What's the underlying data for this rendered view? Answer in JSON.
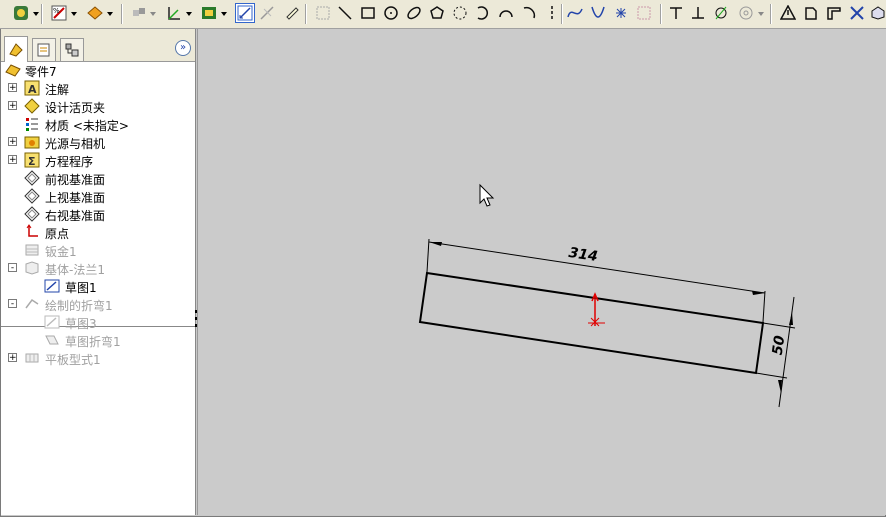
{
  "feature_tree": {
    "root": "零件7",
    "items": [
      {
        "label": "注解",
        "icon": "annotation-icon",
        "expander": "+"
      },
      {
        "label": "设计活页夹",
        "icon": "design-binder-icon",
        "expander": "+"
      },
      {
        "label": "材质 <未指定>",
        "icon": "material-icon",
        "expander": ""
      },
      {
        "label": "光源与相机",
        "icon": "lights-cameras-icon",
        "expander": "+"
      },
      {
        "label": "方程程序",
        "icon": "equations-icon",
        "expander": "+"
      },
      {
        "label": "前视基准面",
        "icon": "plane-icon",
        "expander": ""
      },
      {
        "label": "上视基准面",
        "icon": "plane-icon",
        "expander": ""
      },
      {
        "label": "右视基准面",
        "icon": "plane-icon",
        "expander": ""
      },
      {
        "label": "原点",
        "icon": "origin-icon",
        "expander": ""
      },
      {
        "label": "钣金1",
        "icon": "sheet-metal-icon",
        "expander": "",
        "dim": true
      },
      {
        "label": "基体-法兰1",
        "icon": "base-flange-icon",
        "expander": "-",
        "dim": true
      },
      {
        "label": "草图1",
        "icon": "sketch-icon",
        "expander": "",
        "child": true
      },
      {
        "label": "绘制的折弯1",
        "icon": "sketched-bend-icon",
        "expander": "-",
        "dim": true
      },
      {
        "label": "草图3",
        "icon": "sketch-icon",
        "expander": "",
        "child": true,
        "dim": true
      },
      {
        "label": "草图折弯1",
        "icon": "sketch-bend-icon",
        "expander": "",
        "child": true,
        "dim": true
      },
      {
        "label": "平板型式1",
        "icon": "flat-pattern-icon",
        "expander": "+",
        "dim": true
      }
    ]
  },
  "sketch": {
    "length_dim": "314",
    "width_dim": "50"
  },
  "colors": {
    "toolbar_bg": "#ece9d8",
    "canvas_bg": "#cbcbcb",
    "sketch_line": "#000000",
    "origin": "#e00000",
    "accent": "#3366cc"
  }
}
